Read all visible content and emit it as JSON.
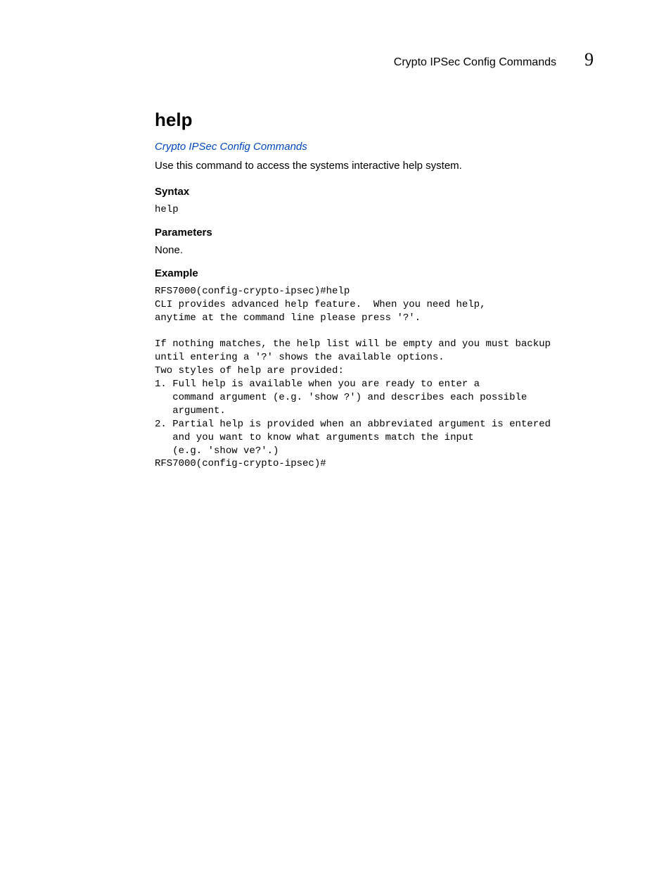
{
  "header": {
    "section_title": "Crypto IPSec Config Commands",
    "chapter_number": "9"
  },
  "doc": {
    "title": "help",
    "link_text": "Crypto IPSec Config Commands",
    "description": "Use this command to access the systems interactive help system.",
    "syntax_heading": "Syntax",
    "syntax_code": "help",
    "parameters_heading": "Parameters",
    "parameters_value": "None.",
    "example_heading": "Example",
    "example_code": "RFS7000(config-crypto-ipsec)#help\nCLI provides advanced help feature.  When you need help,\nanytime at the command line please press '?'.\n\nIf nothing matches, the help list will be empty and you must backup\nuntil entering a '?' shows the available options.\nTwo styles of help are provided:\n1. Full help is available when you are ready to enter a\n   command argument (e.g. 'show ?') and describes each possible\n   argument.\n2. Partial help is provided when an abbreviated argument is entered\n   and you want to know what arguments match the input\n   (e.g. 'show ve?'.)\nRFS7000(config-crypto-ipsec)#"
  }
}
